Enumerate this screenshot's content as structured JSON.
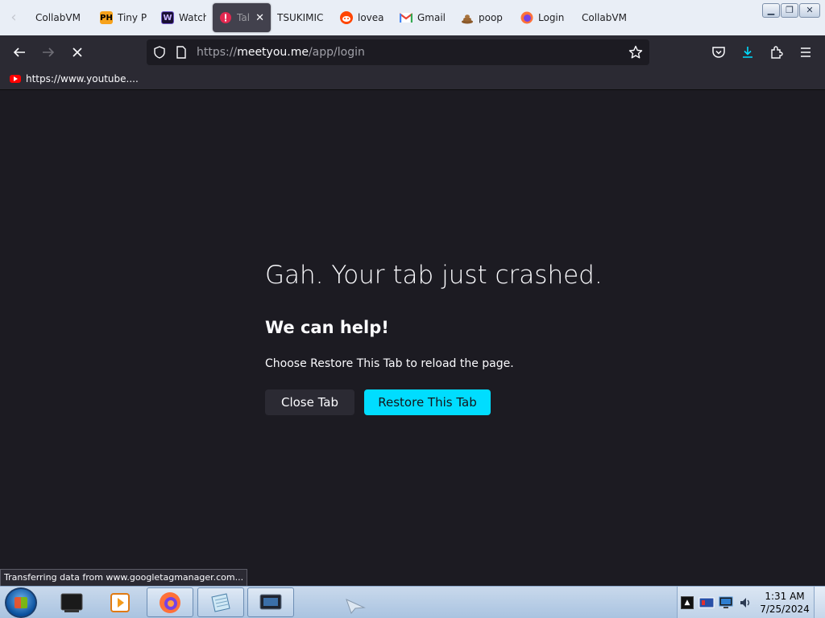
{
  "tabs": [
    {
      "label": "CollabVM",
      "favicon": "none"
    },
    {
      "label": "Tiny P",
      "favicon": "PH"
    },
    {
      "label": "Watch",
      "favicon": "W"
    },
    {
      "label": "Tab",
      "favicon": "crash-icon",
      "active": true
    },
    {
      "label": "TSUKIMIC",
      "favicon": "none"
    },
    {
      "label": "lovea",
      "favicon": "reddit-icon"
    },
    {
      "label": "Gmail",
      "favicon": "gmail-icon"
    },
    {
      "label": "poop",
      "favicon": "poop-icon"
    },
    {
      "label": "Login",
      "favicon": "firefox-icon"
    },
    {
      "label": "CollabVM",
      "favicon": "none"
    }
  ],
  "url": {
    "scheme": "https://",
    "domain": "meetyou.me",
    "path": "/app/login"
  },
  "bookmarks": [
    {
      "label": "https://www.youtube...."
    }
  ],
  "crash": {
    "title": "Gah. Your tab just crashed.",
    "subtitle": "We can help!",
    "description": "Choose Restore This Tab to reload the page.",
    "close_label": "Close Tab",
    "restore_label": "Restore This Tab"
  },
  "status_text": "Transferring data from www.googletagmanager.com...",
  "clock": {
    "time": "1:31 AM",
    "date": "7/25/2024"
  },
  "colors": {
    "accent": "#00ddff",
    "content_bg": "#1c1b22",
    "toolbar_bg": "#2b2a33"
  }
}
